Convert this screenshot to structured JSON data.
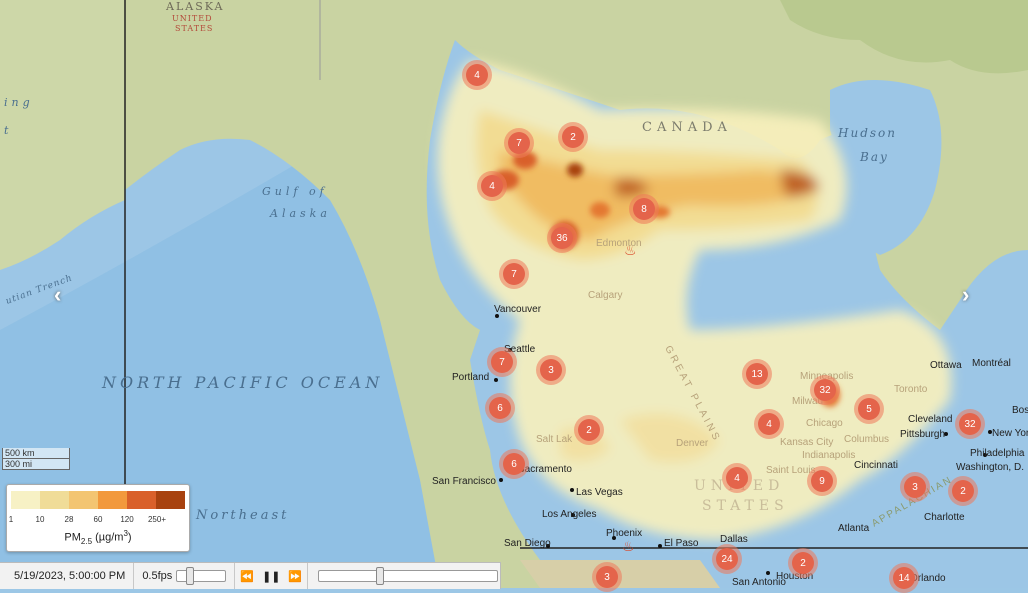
{
  "labels": {
    "ocean_main": "NORTH PACIFIC OCEAN",
    "ocean_northeast": "Northeast",
    "gulf_line1": "Gulf of",
    "gulf_line2": "Alaska",
    "alaska": "ALASKA",
    "united_states_top1": "UNITED",
    "united_states_top2": "STATES",
    "canada": "CANADA",
    "hudson1": "Hudson",
    "hudson2": "Bay",
    "united_states1": "UNITED",
    "united_states2": "STATES",
    "trench": "utian Trench",
    "ing": "ing",
    "apos": "t"
  },
  "cities": {
    "vancouver": "Vancouver",
    "seattle": "Seattle",
    "portland": "Portland",
    "san_francisco": "San Francisco",
    "sacramento": "Sacramento",
    "los_angeles": "Los Angeles",
    "las_vegas": "Las Vegas",
    "san_diego": "San Diego",
    "phoenix": "Phoenix",
    "el_paso": "El Paso",
    "dallas": "Dallas",
    "houston": "Houston",
    "san_antonio": "San Antonio",
    "denver": "Denver",
    "salt_lake": "Salt Lak",
    "calgary": "Calgary",
    "edmonton": "Edmonton",
    "kansas_city": "Kansas City",
    "saint_louis": "Saint Louis",
    "chicago": "Chicago",
    "milwaukee": "Milwau",
    "minneapolis": "Minneapolis",
    "indianapolis": "Indianapolis",
    "cincinnati": "Cincinnati",
    "columbus": "Columbus",
    "cleveland": "Cleveland",
    "pittsburgh": "Pittsburgh",
    "toronto": "Toronto",
    "ottawa": "Ottawa",
    "montreal": "Montréal",
    "new_york": "New York",
    "philadelphia": "Philadelphia",
    "washington": "Washington, D.",
    "charlotte": "Charlotte",
    "atlanta": "Atlanta",
    "orlando": "Orlando",
    "bos": "Bos",
    "great_plains": "GREAT PLAINS",
    "appalachian": "APPALACHIAN"
  },
  "clusters": [
    {
      "id": "c1",
      "count": "4"
    },
    {
      "id": "c2",
      "count": "7"
    },
    {
      "id": "c3",
      "count": "2"
    },
    {
      "id": "c4",
      "count": "4"
    },
    {
      "id": "c5",
      "count": "8"
    },
    {
      "id": "c6",
      "count": "36"
    },
    {
      "id": "c7",
      "count": "7"
    },
    {
      "id": "c8",
      "count": "7"
    },
    {
      "id": "c9",
      "count": "3"
    },
    {
      "id": "c10",
      "count": "6"
    },
    {
      "id": "c11",
      "count": "2"
    },
    {
      "id": "c12",
      "count": "6"
    },
    {
      "id": "c13",
      "count": "13"
    },
    {
      "id": "c14",
      "count": "32"
    },
    {
      "id": "c15",
      "count": "5"
    },
    {
      "id": "c16",
      "count": "4"
    },
    {
      "id": "c17",
      "count": "4"
    },
    {
      "id": "c18",
      "count": "9"
    },
    {
      "id": "c19",
      "count": "32"
    },
    {
      "id": "c20",
      "count": "3"
    },
    {
      "id": "c21",
      "count": "2"
    },
    {
      "id": "c22",
      "count": "24"
    },
    {
      "id": "c23",
      "count": "2"
    },
    {
      "id": "c24",
      "count": "3"
    },
    {
      "id": "c25",
      "count": "14"
    }
  ],
  "legend": {
    "colors": [
      "#f7f1c5",
      "#f0dc98",
      "#f3c572",
      "#f2993d",
      "#d9602a",
      "#a8420f",
      "#5e2207"
    ],
    "ticks": [
      "1",
      "10",
      "28",
      "60",
      "120",
      "250+"
    ],
    "title_main": "PM",
    "title_sub": "2.5",
    "title_unit": " (µg/m",
    "title_sup": "3",
    "title_close": ")"
  },
  "scale": {
    "km": "500 km",
    "mi": "300 mi"
  },
  "controls": {
    "datetime": "5/19/2023, 5:00:00 PM",
    "fps": "0.5fps",
    "fps_fraction": 0.2,
    "timeline_fraction": 0.33,
    "rewind_icon": "rewind-icon",
    "pause_icon": "pause-icon",
    "forward_icon": "fast-forward-icon"
  },
  "nav": {
    "prev_icon": "chevron-left-icon",
    "next_icon": "chevron-right-icon"
  }
}
